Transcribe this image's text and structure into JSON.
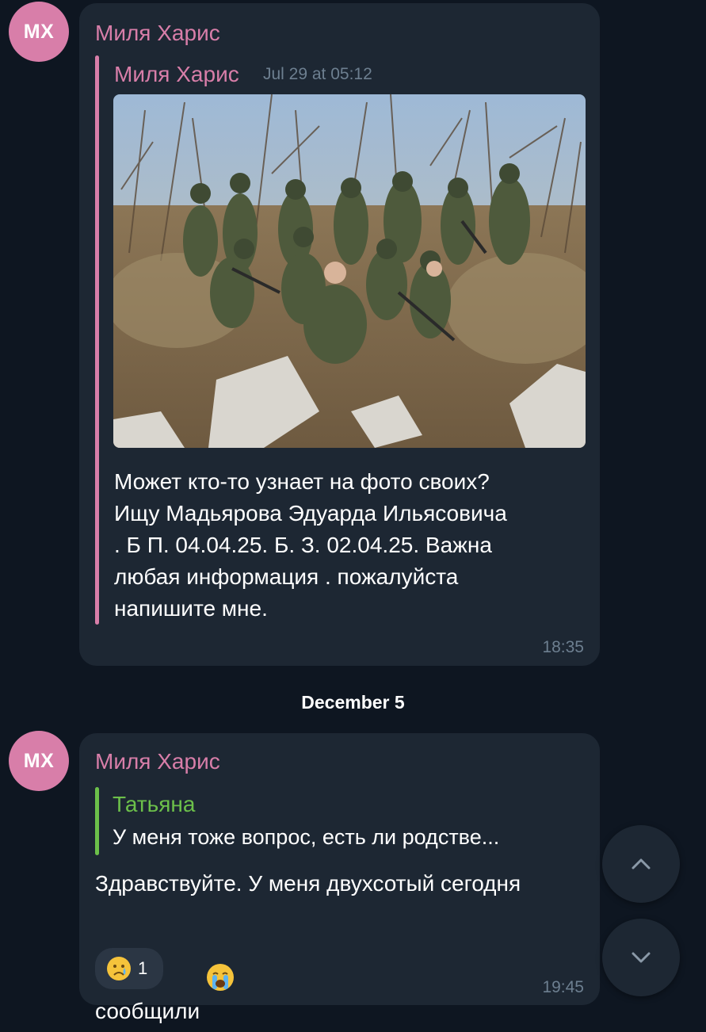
{
  "messages": [
    {
      "avatar_initials": "МХ",
      "sender": "Миля Харис",
      "forwarded_from": "Миля Харис",
      "forwarded_date": "Jul 29 at 05:12",
      "photo_alt": "group-photo",
      "text": "Может кто-то узнает на фото своих?\nИщу Мадьярова Эдуарда Ильясовича\n. Б П. 04.04.25. Б. З. 02.04.25. Важна\nлюбая информация . пожалуйста\nнапишите мне.",
      "time": "18:35"
    },
    {
      "avatar_initials": "МХ",
      "sender": "Миля Харис",
      "reply_to_name": "Татьяна",
      "reply_to_text": "У меня тоже вопрос, есть ли родстве...",
      "text": "Здравствуйте. У меня двухсотый сегодня\nсообщили",
      "emoji_icon": "loudly-crying-face-icon",
      "reaction": {
        "icon": "crying-face-icon",
        "count": "1"
      },
      "time": "19:45"
    }
  ],
  "date_separator": "December 5",
  "buttons": {
    "scroll_up_icon": "chevron-up-icon",
    "scroll_down_icon": "chevron-down-icon"
  },
  "colors": {
    "background": "#0e1621",
    "bubble": "#1d2733",
    "accent_pink": "#d87ea9",
    "reply_green": "#6cc04a",
    "meta_gray": "#6d7f90"
  }
}
